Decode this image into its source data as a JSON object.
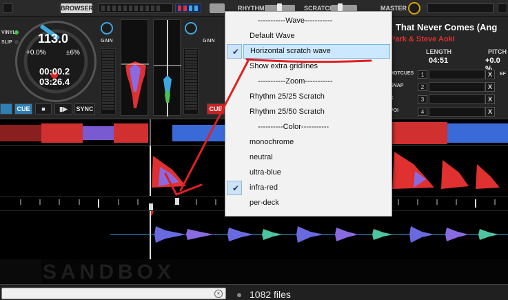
{
  "topbar": {
    "browser_label": "BROWSER",
    "rhythm_label": "RHYTHM",
    "scratch_label": "SCRATCH",
    "master_label": "MASTER"
  },
  "deck_left": {
    "bpm": "113.0",
    "pitch": "+0.0%",
    "pitch_range": "±6%",
    "elapsed": "00:00.2",
    "remaining": "03:26.4",
    "vinyl_label": "VINYL",
    "slip_label": "SLIP",
    "gain_label": "GAIN",
    "cue_label": "CUE",
    "sync_label": "SYNC"
  },
  "deck_right": {
    "cue_label": "CUE",
    "gain_label": "GAIN",
    "title": ": That Never Comes (Ang",
    "artist": "Park & Steve Aoki",
    "length_label": "LENGTH",
    "length_value": "04:51",
    "pitch_label": "PITCH",
    "pitch_value": "+0.0 %",
    "cue_rows": [
      {
        "label": "HOTCUES",
        "num": "1"
      },
      {
        "label": "SNAP",
        "num": "2"
      },
      {
        "label": "K",
        "num": "3"
      },
      {
        "label": "POI",
        "num": "4"
      }
    ],
    "x_label": "X",
    "ef_label": "EF"
  },
  "menu": {
    "items": [
      {
        "label": "-----------Wave-----------",
        "separator": true
      },
      {
        "label": "Default Wave",
        "checked": false
      },
      {
        "label": "Horizontal scratch wave",
        "checked": true,
        "hover": true
      },
      {
        "label": "Show extra gridlines",
        "checked": false
      },
      {
        "label": "-----------Zoom-----------",
        "separator": true
      },
      {
        "label": "Rhythm 25/25 Scratch",
        "checked": false
      },
      {
        "label": "Rhythm 25/50 Scratch",
        "checked": false
      },
      {
        "label": "----------Color-----------",
        "separator": true
      },
      {
        "label": "monochrome",
        "checked": false
      },
      {
        "label": "neutral",
        "checked": false
      },
      {
        "label": "ultra-blue",
        "checked": false
      },
      {
        "label": "infra-red",
        "checked": true
      },
      {
        "label": "per-deck",
        "checked": false
      }
    ],
    "checkmark_glyph": "✔"
  },
  "sandbox_label": "SANDBOX",
  "browser": {
    "search_value": "",
    "clear_glyph": "×",
    "file_count": "1082 files"
  },
  "colors": {
    "accent_blue": "#3ea7e0",
    "accent_red": "#e03030",
    "annotation_red": "#e02020"
  }
}
